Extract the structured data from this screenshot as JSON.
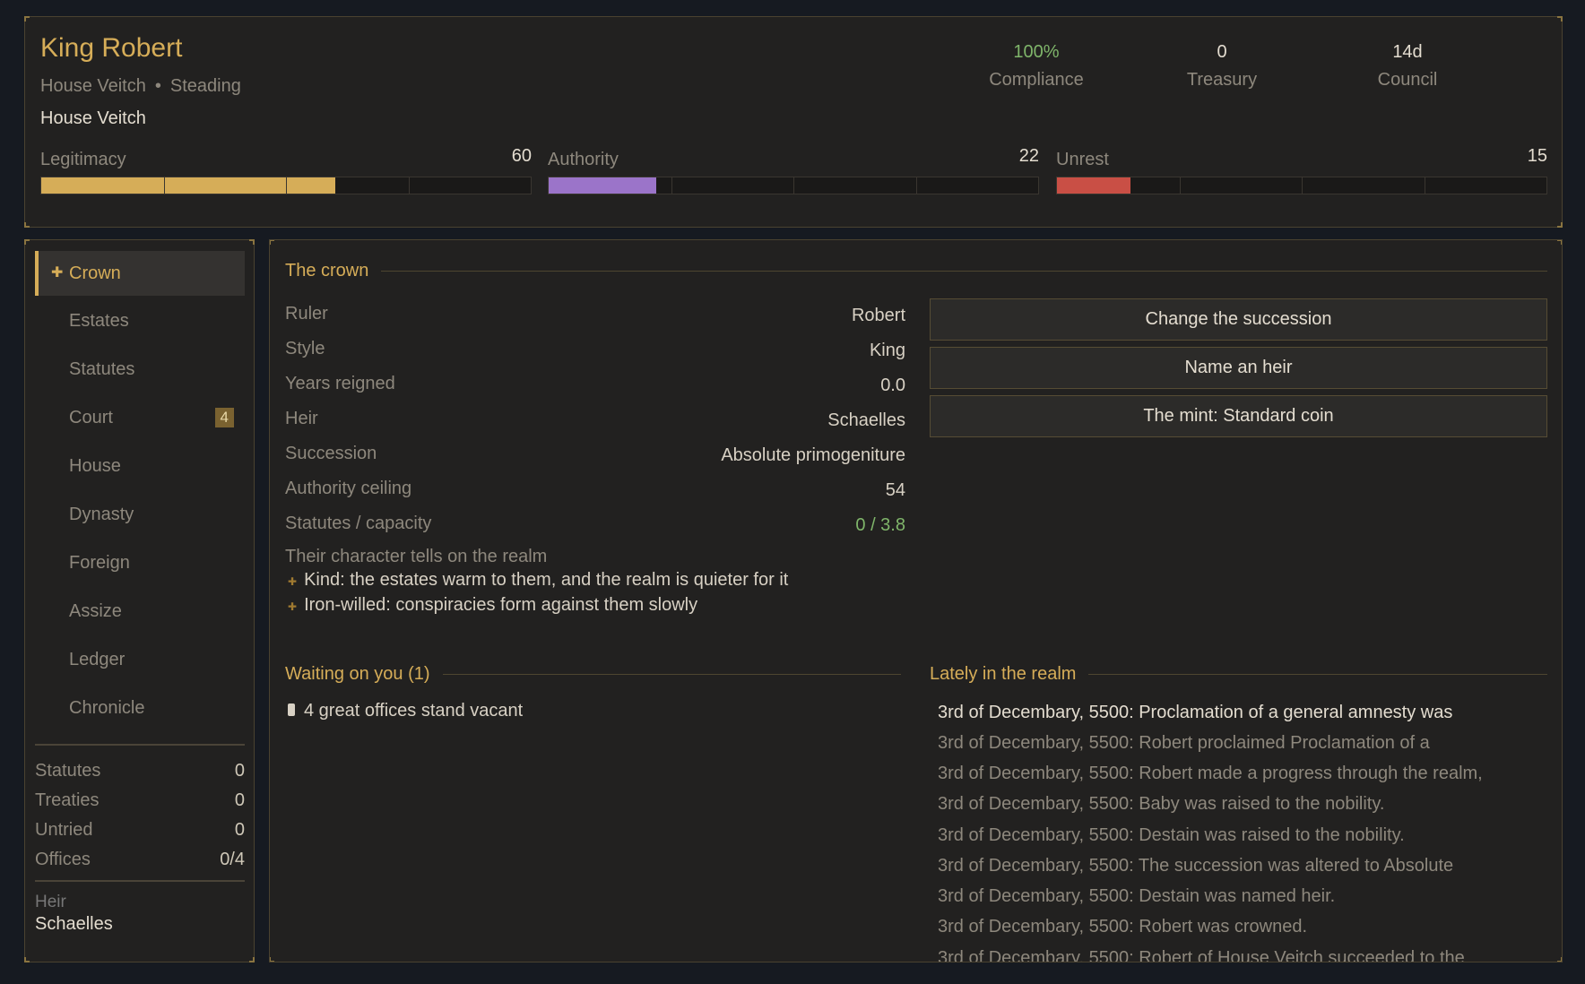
{
  "header": {
    "title": "King Robert",
    "house": "House Veitch",
    "dot": "•",
    "seat": "Steading",
    "house_line": "House Veitch",
    "stats": [
      {
        "value": "100%",
        "label": "Compliance",
        "color": "#7fb56a"
      },
      {
        "value": "0",
        "label": "Treasury"
      },
      {
        "value": "14d",
        "label": "Council"
      }
    ],
    "meters": [
      {
        "label": "Legitimacy",
        "value": 60,
        "max": 100,
        "color": "#d6ad58"
      },
      {
        "label": "Authority",
        "value": 22,
        "max": 100,
        "color": "#9b74c9"
      },
      {
        "label": "Unrest",
        "value": 15,
        "max": 100,
        "color": "#c94f45"
      }
    ]
  },
  "sidebar": {
    "items": [
      {
        "label": "Crown",
        "active": true,
        "icon": "crown-icon"
      },
      {
        "label": "Estates"
      },
      {
        "label": "Statutes"
      },
      {
        "label": "Court",
        "badge": "4"
      },
      {
        "label": "House"
      },
      {
        "label": "Dynasty"
      },
      {
        "label": "Foreign"
      },
      {
        "label": "Assize"
      },
      {
        "label": "Ledger"
      },
      {
        "label": "Chronicle"
      }
    ],
    "stats": [
      {
        "label": "Statutes",
        "value": "0"
      },
      {
        "label": "Treaties",
        "value": "0"
      },
      {
        "label": "Untried",
        "value": "0"
      },
      {
        "label": "Offices",
        "value": "0/4"
      }
    ],
    "heir_label": "Heir",
    "heir_value": "Schaelles"
  },
  "crown": {
    "title": "The crown",
    "rows": [
      {
        "key": "Ruler",
        "value": "Robert"
      },
      {
        "key": "Style",
        "value": "King"
      },
      {
        "key": "Years reigned",
        "value": "0.0"
      },
      {
        "key": "Heir",
        "value": "Schaelles"
      },
      {
        "key": "Succession",
        "value": "Absolute primogeniture"
      },
      {
        "key": "Authority ceiling",
        "value": "54"
      },
      {
        "key": "Statutes / capacity",
        "value": "0 / 3.8",
        "green": true
      }
    ],
    "traits_heading": "Their character tells on the realm",
    "traits": [
      "Kind: the estates warm to them, and the realm is quieter for it",
      "Iron-willed: conspiracies form against them slowly"
    ],
    "actions": [
      "Change the succession",
      "Name an heir",
      "The mint: Standard coin"
    ]
  },
  "waiting": {
    "title": "Waiting on you (1)",
    "items": [
      "4 great offices stand vacant"
    ]
  },
  "lately": {
    "title": "Lately in the realm",
    "entries": [
      "3rd of Decembary, 5500: Proclamation of a general amnesty was",
      "3rd of Decembary, 5500: Robert proclaimed Proclamation of a",
      "3rd of Decembary, 5500: Robert made a progress through the realm,",
      "3rd of Decembary, 5500: Baby was raised to the nobility.",
      "3rd of Decembary, 5500: Destain was raised to the nobility.",
      "3rd of Decembary, 5500: The succession was altered to Absolute",
      "3rd of Decembary, 5500: Destain was named heir.",
      "3rd of Decembary, 5500: Robert was crowned.",
      "3rd of Decembary, 5500: Robert of House Veitch succeeded to the"
    ]
  }
}
